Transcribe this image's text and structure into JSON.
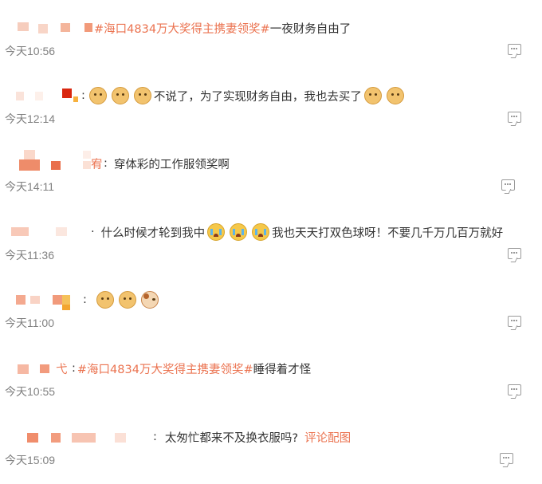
{
  "colors": {
    "link": "#eb7350",
    "text": "#333333",
    "time": "#808080"
  },
  "comments": [
    {
      "hashtag": "#海口4834万大奖得主携妻领奖#",
      "text": "一夜财务自由了",
      "time": "今天10:56"
    },
    {
      "text": "不说了，为了实现财务自由，我也去买了",
      "time": "今天12:14",
      "emoji": [
        "doge",
        "doge",
        "doge",
        "doge",
        "doge"
      ]
    },
    {
      "name_tail": "宥",
      "text": "穿体彩的工作服领奖啊",
      "time": "今天14:11"
    },
    {
      "text_before": "什么时候才轮到我中",
      "text_after": "我也天天打双色球呀！不要几千万几百万就好",
      "time": "今天11:36",
      "emoji": [
        "cry",
        "cry",
        "cry"
      ]
    },
    {
      "time": "今天11:00",
      "emoji": [
        "doge",
        "doge",
        "cat"
      ]
    },
    {
      "name_tail": "弋",
      "hashtag": "#海口4834万大奖得主携妻领奖#",
      "text": "睡得着才怪",
      "time": "今天10:55"
    },
    {
      "text": "太匆忙都来不及换衣服吗?",
      "link": "评论配图",
      "time": "今天15:09"
    }
  ]
}
